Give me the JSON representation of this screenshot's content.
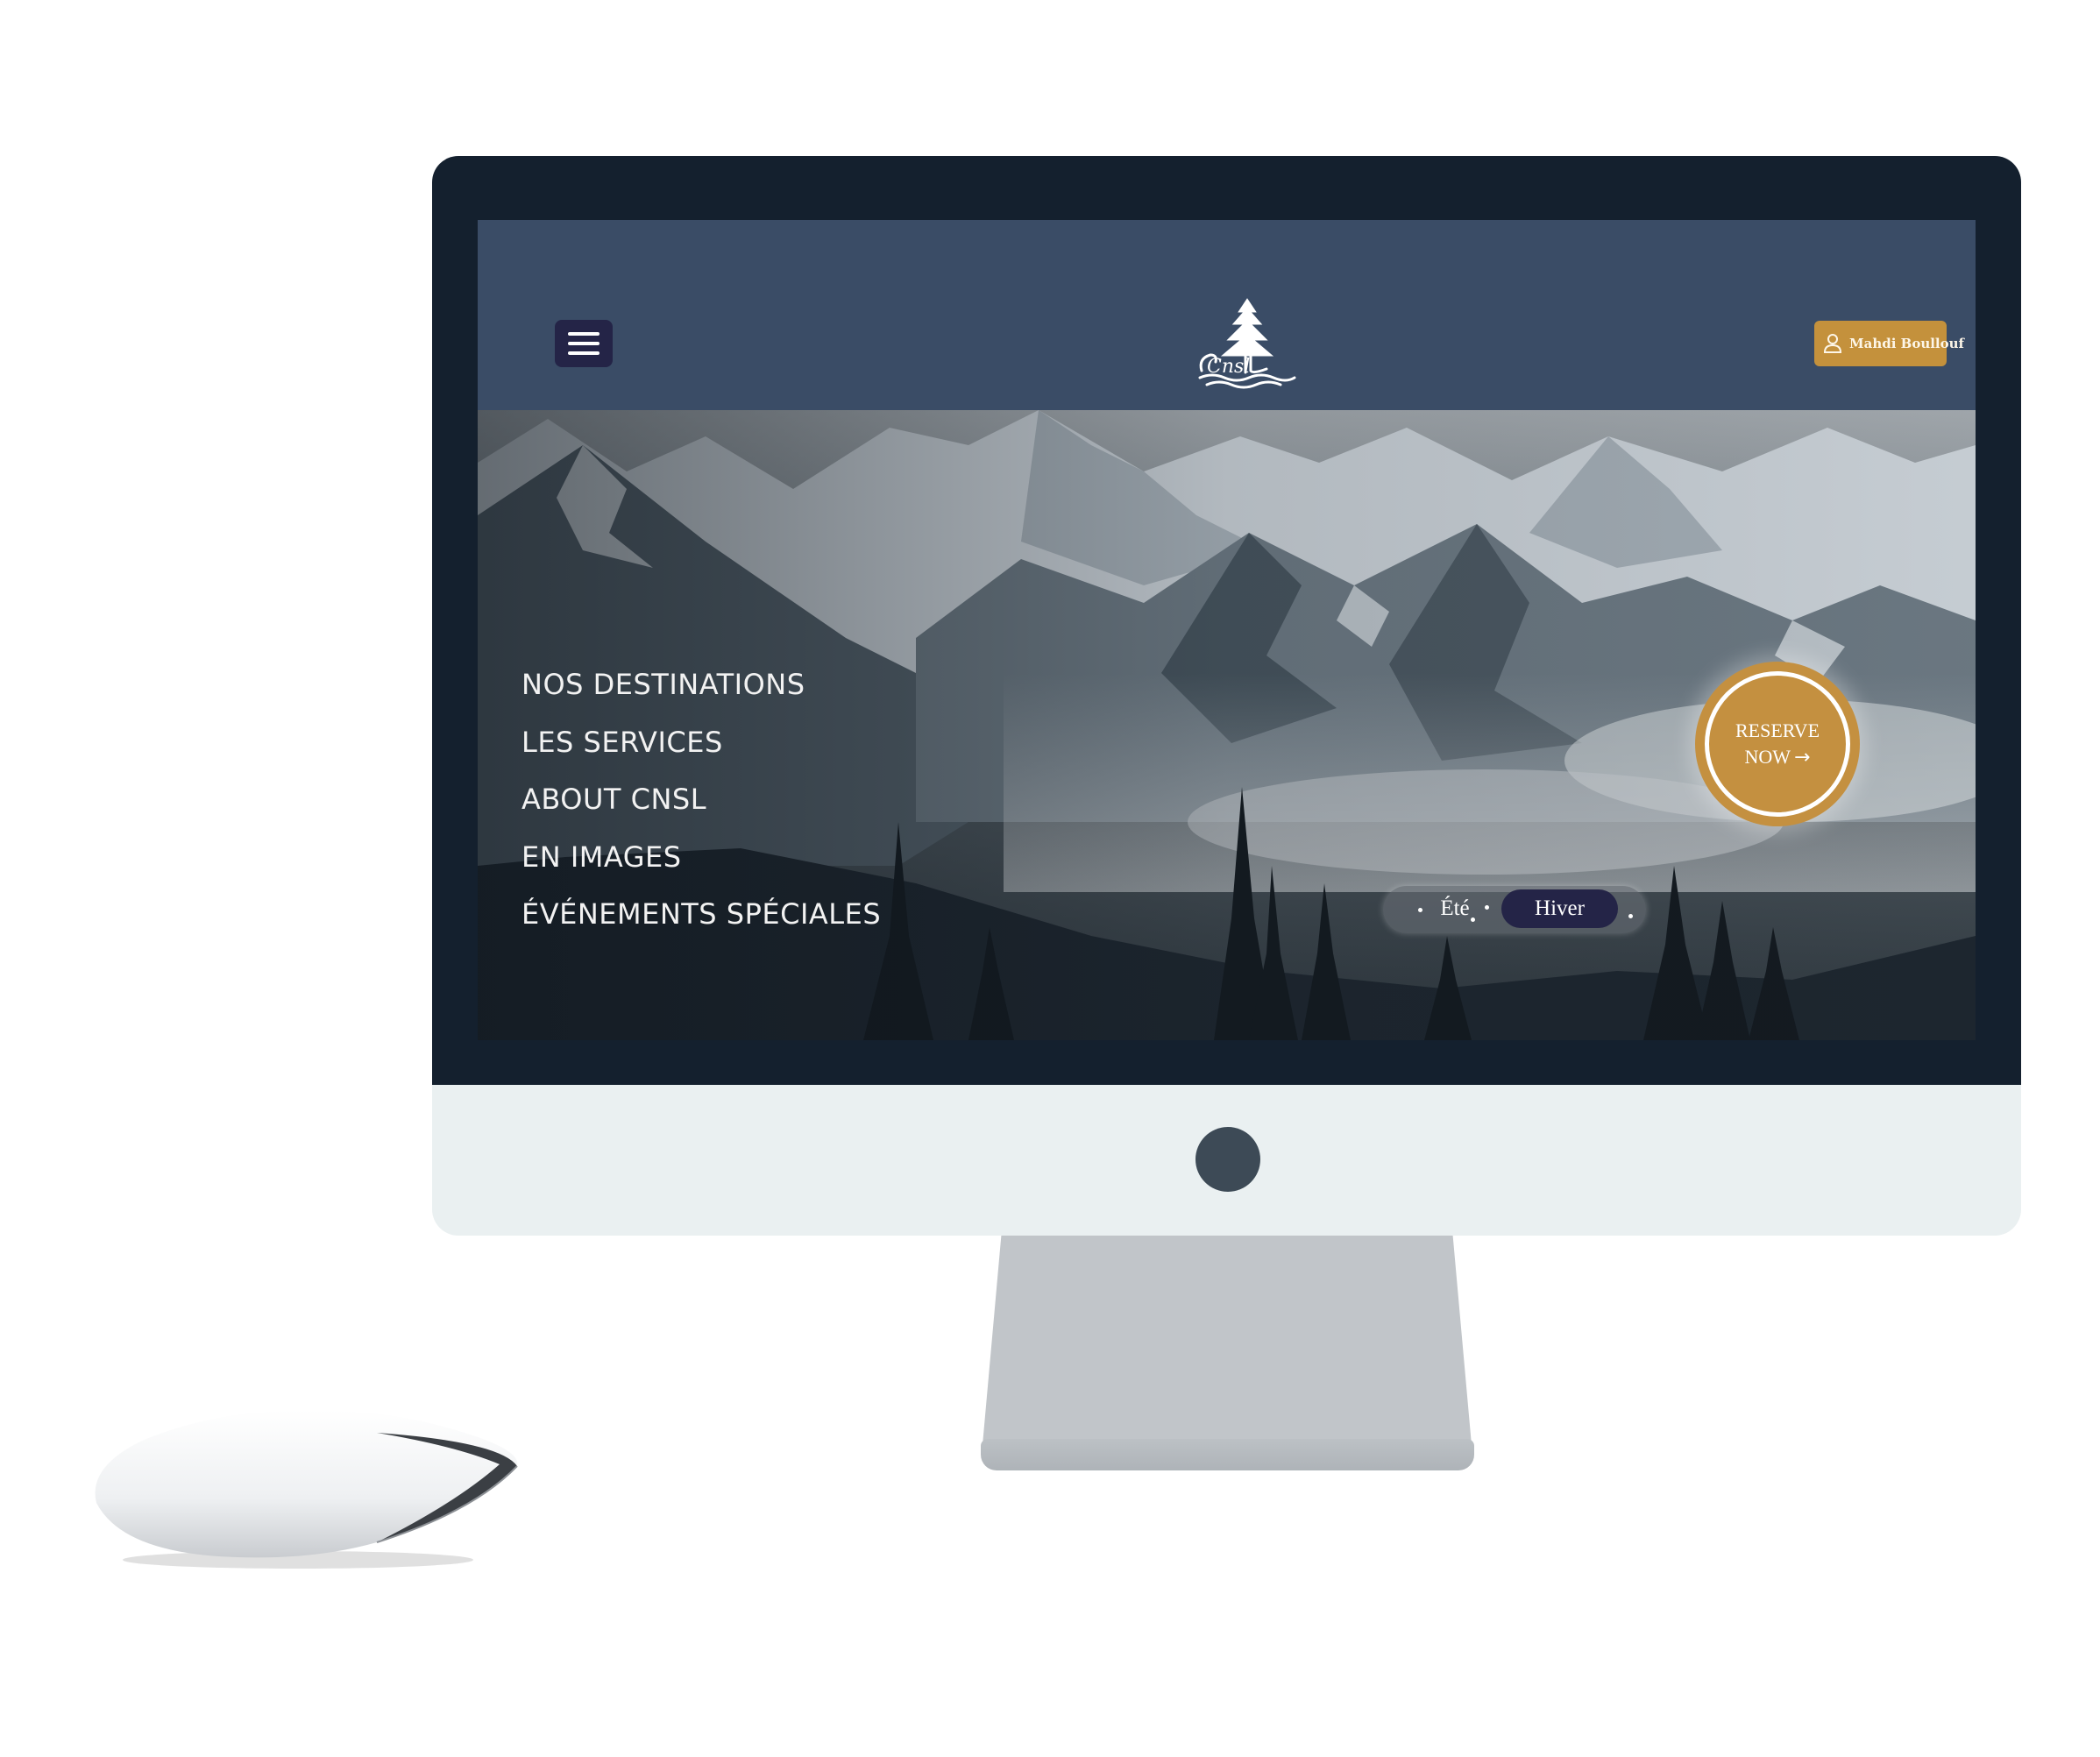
{
  "site": {
    "user_label": "Mahdi Boullouf",
    "logo_text": "Cnsl"
  },
  "nav": {
    "items": [
      {
        "label": "NOS DESTINATIONS"
      },
      {
        "label": "LES SERVICES"
      },
      {
        "label": "ABOUT CNSL"
      },
      {
        "label": "EN IMAGES"
      },
      {
        "label": "ÉVÉNEMENTS SPÉCIALES"
      }
    ]
  },
  "reserve": {
    "line1": "RESERVE",
    "line2": "NOW",
    "arrow": "→"
  },
  "season_toggle": {
    "options": [
      "Été",
      "Hiver"
    ],
    "selected": "Hiver"
  },
  "colors": {
    "header_bg": "#3a4c66",
    "accent_gold": "#c4913c",
    "menu_button_bg": "#242447",
    "monitor_bezel": "#14202e",
    "monitor_chin": "#eaf0f1"
  },
  "icons": {
    "menu": "hamburger-icon",
    "user": "user-icon",
    "arrow": "arrow-right-icon",
    "monitor_logo": "apple-logo-icon"
  }
}
